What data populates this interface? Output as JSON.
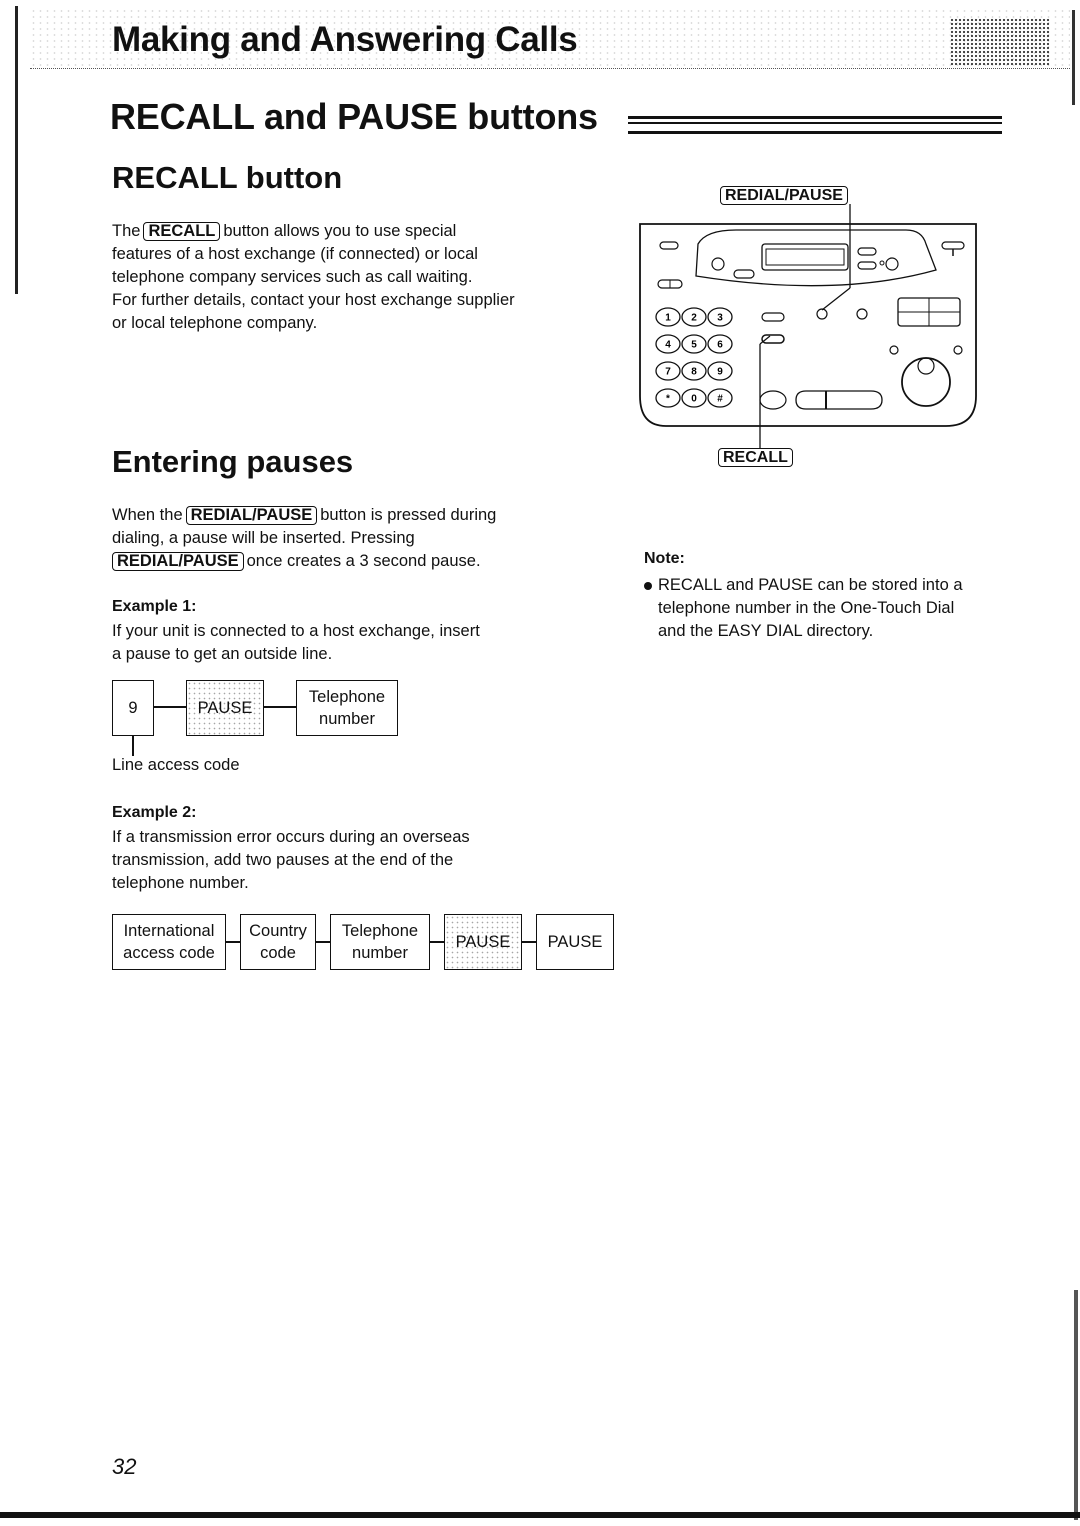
{
  "header": {
    "chapter_title": "Making and Answering Calls",
    "section_title": "RECALL and PAUSE buttons"
  },
  "recall": {
    "title": "RECALL button",
    "key": "RECALL",
    "text_before": "The",
    "line1": "button allows you to use special",
    "line2": "features of a host exchange (if connected) or local",
    "line3": "telephone company services such as call waiting.",
    "line4": "For further details, contact your host exchange supplier",
    "line5": "or local telephone company."
  },
  "diagram": {
    "top_key": "REDIAL/PAUSE",
    "bottom_key": "RECALL",
    "keypad": [
      "1",
      "2",
      "3",
      "4",
      "5",
      "6",
      "7",
      "8",
      "9",
      "*",
      "0",
      "#"
    ],
    "icon": "fax-control-panel-illustration"
  },
  "pauses": {
    "title": "Entering pauses",
    "when_the": "When the",
    "key": "REDIAL/PAUSE",
    "line1_rest": "button is pressed during",
    "line2": "dialing, a pause will be inserted. Pressing",
    "line3_rest": "once creates a 3 second pause.",
    "example1": {
      "label": "Example 1:",
      "line1": "If your unit is connected to a host exchange, insert",
      "line2": "a pause to get an outside line.",
      "boxes": [
        "9",
        "PAUSE",
        "Telephone number"
      ],
      "caption": "Line access code"
    },
    "example2": {
      "label": "Example 2:",
      "line1": "If a transmission error occurs during an overseas",
      "line2": "transmission, add two pauses at the end of the",
      "line3": "telephone number.",
      "boxes": [
        "International access code",
        "Country code",
        "Telephone number",
        "PAUSE",
        "PAUSE"
      ]
    }
  },
  "note": {
    "label": "Note:",
    "line1": "RECALL and PAUSE can be stored into a",
    "line2": "telephone number in the One-Touch Dial",
    "line3": "and the EASY DIAL directory."
  },
  "footer": {
    "page_number": "32"
  }
}
